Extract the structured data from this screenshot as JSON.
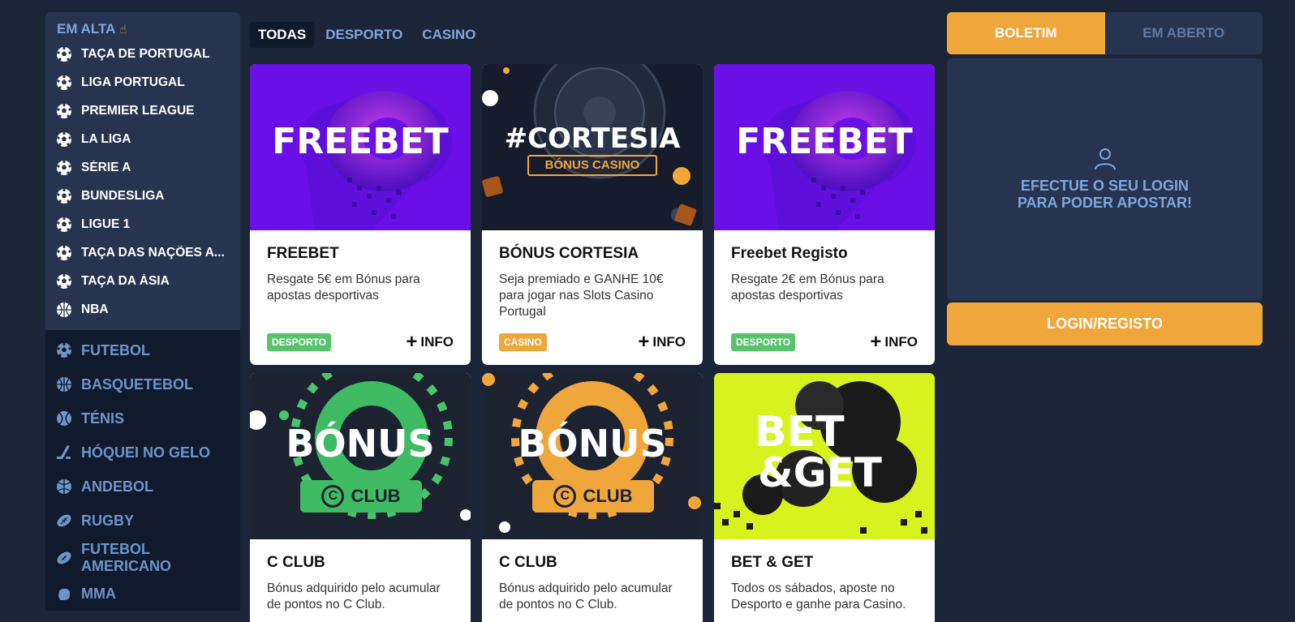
{
  "sidebar": {
    "hot_title": "EM ALTA",
    "hot_items": [
      {
        "label": "TAÇA DE PORTUGAL",
        "icon": "soccer-ball-icon"
      },
      {
        "label": "LIGA PORTUGAL",
        "icon": "soccer-ball-icon"
      },
      {
        "label": "PREMIER LEAGUE",
        "icon": "soccer-ball-icon"
      },
      {
        "label": "LA LIGA",
        "icon": "soccer-ball-icon"
      },
      {
        "label": "SÉRIE A",
        "icon": "soccer-ball-icon"
      },
      {
        "label": "BUNDESLIGA",
        "icon": "soccer-ball-icon"
      },
      {
        "label": "LIGUE 1",
        "icon": "soccer-ball-icon"
      },
      {
        "label": "TAÇA DAS NAÇÕES A...",
        "icon": "soccer-ball-icon"
      },
      {
        "label": "TAÇA DA ÁSIA",
        "icon": "soccer-ball-icon"
      },
      {
        "label": "NBA",
        "icon": "basketball-icon"
      }
    ],
    "sports": [
      {
        "label": "FUTEBOL",
        "icon": "soccer-ball-icon"
      },
      {
        "label": "BASQUETEBOL",
        "icon": "basketball-icon"
      },
      {
        "label": "TÉNIS",
        "icon": "tennis-ball-icon"
      },
      {
        "label": "HÓQUEI NO GELO",
        "icon": "hockey-stick-icon"
      },
      {
        "label": "ANDEBOL",
        "icon": "handball-icon"
      },
      {
        "label": "RUGBY",
        "icon": "rugby-ball-icon"
      },
      {
        "label": "FUTEBOL AMERICANO",
        "icon": "american-football-icon"
      },
      {
        "label": "MMA",
        "icon": "glove-icon"
      }
    ]
  },
  "tabs": [
    {
      "label": "TODAS",
      "active": true
    },
    {
      "label": "DESPORTO",
      "active": false
    },
    {
      "label": "CASINO",
      "active": false
    }
  ],
  "promos": [
    {
      "banner_text": "FREEBET",
      "title": "FREEBET",
      "desc": "Resgate 5€ em Bónus para apostas desportivas",
      "badge": "DESPORTO",
      "info": "INFO"
    },
    {
      "banner_text": "#CORTESIA",
      "banner_sub": "BÓNUS CASINO",
      "title": "BÓNUS CORTESIA",
      "desc": "Seja premiado e GANHE 10€ para jogar nas Slots Casino Portugal",
      "badge": "CASINO",
      "info": "INFO"
    },
    {
      "banner_text": "FREEBET",
      "title": "Freebet Registo",
      "desc": "Resgate 2€ em Bónus para apostas desportivas",
      "badge": "DESPORTO",
      "info": "INFO"
    },
    {
      "banner_text": "BÓNUS",
      "banner_sub": "CLUB",
      "banner_sub_letter": "C",
      "title": "C CLUB",
      "desc": "Bónus adquirido pelo acumular de pontos no C Club."
    },
    {
      "banner_text": "BÓNUS",
      "banner_sub": "CLUB",
      "banner_sub_letter": "C",
      "title": "C CLUB",
      "desc": "Bónus adquirido pelo acumular de pontos no C Club."
    },
    {
      "banner_text": "BET",
      "banner_text2": "&GET",
      "title": "BET & GET",
      "desc": "Todos os sábados, aposte no Desporto e ganhe para Casino."
    }
  ],
  "betslip": {
    "tab_active": "BOLETIM",
    "tab_inactive": "EM ABERTO",
    "message_line1": "EFECTUE O SEU LOGIN",
    "message_line2": "PARA PODER APOSTAR!",
    "login_button": "LOGIN/REGISTO"
  },
  "colors": {
    "background": "#1c2538",
    "panel": "#26344f",
    "dark_panel": "#0f1a2d",
    "accent": "#efa63b",
    "link_blue": "#7ea6dc",
    "badge_green": "#57c46b"
  }
}
